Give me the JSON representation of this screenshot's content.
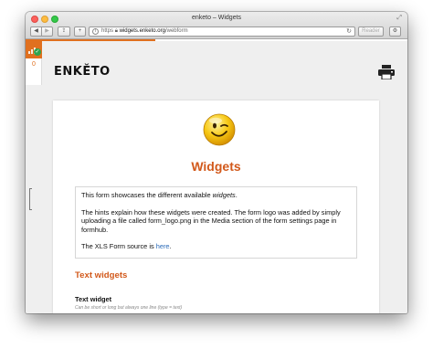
{
  "window": {
    "title": "enketo – Widgets"
  },
  "toolbar": {
    "back_glyph": "◀",
    "forward_glyph": "▶",
    "share_glyph": "⇪",
    "add_glyph": "+",
    "url_scheme": "https",
    "url_host": "widgets.enketo.org",
    "url_path": "/webform",
    "reload_glyph": "↻",
    "reader_label": "Reader",
    "settings_glyph": "⚙"
  },
  "side_panel": {
    "queue_count": "0"
  },
  "header": {
    "logo_text": "ENKĚTO"
  },
  "form": {
    "title": "Widgets",
    "hint_p1_a": "This form showcases the different available ",
    "hint_p1_em": "widgets",
    "hint_p1_b": ".",
    "hint_p2": "The hints explain how these widgets were created. The form logo was added by simply uploading a file called form_logo.png in the Media section of the form settings page in formhub.",
    "hint_p3_a": "The XLS Form source is ",
    "hint_p3_link": "here",
    "hint_p3_b": ".",
    "section_title": "Text widgets",
    "question_label": "Text widget",
    "question_hint": "Can be short or long but always one line (type = text)"
  },
  "colors": {
    "accent": "#e0701f",
    "title": "#d2591b",
    "link": "#2a6ab8"
  },
  "icons": [
    "signal-icon",
    "check-icon",
    "print-icon",
    "winking-smiley-icon",
    "info-icon",
    "reload-icon"
  ]
}
